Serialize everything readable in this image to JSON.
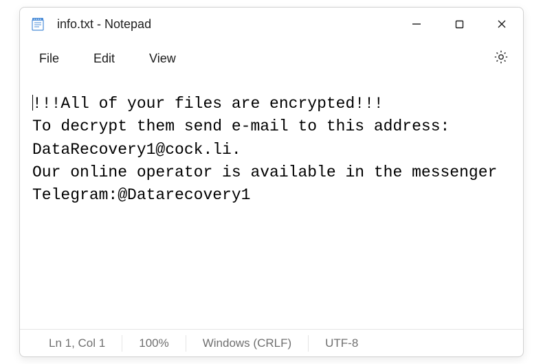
{
  "titlebar": {
    "title": "info.txt - Notepad"
  },
  "menubar": {
    "file": "File",
    "edit": "Edit",
    "view": "View"
  },
  "content": {
    "text": "!!!All of your files are encrypted!!!\nTo decrypt them send e-mail to this address: DataRecovery1@cock.li.\nOur online operator is available in the messenger Telegram:@Datarecovery1"
  },
  "statusbar": {
    "cursor": "Ln 1, Col 1",
    "zoom": "100%",
    "eol": "Windows (CRLF)",
    "encoding": "UTF-8"
  }
}
